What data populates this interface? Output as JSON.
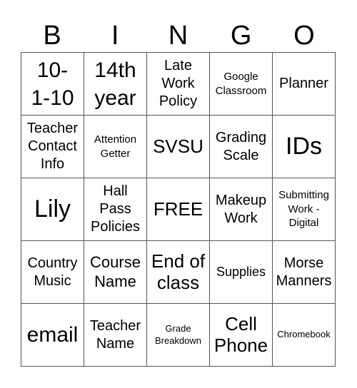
{
  "header": [
    "B",
    "I",
    "N",
    "G",
    "O"
  ],
  "cells": [
    {
      "text": "10-\n1-10",
      "size": "s30"
    },
    {
      "text": "14th\nyear",
      "size": "s30"
    },
    {
      "text": "Late\nWork\nPolicy",
      "size": "s20"
    },
    {
      "text": "Google\nClassroom",
      "size": "s15"
    },
    {
      "text": "Planner",
      "size": "s20"
    },
    {
      "text": "Teacher\nContact\nInfo",
      "size": "s20"
    },
    {
      "text": "Attention\nGetter",
      "size": "s15"
    },
    {
      "text": "SVSU",
      "size": "s26"
    },
    {
      "text": "Grading\nScale",
      "size": "s20"
    },
    {
      "text": "IDs",
      "size": "s34"
    },
    {
      "text": "Lily",
      "size": "s34"
    },
    {
      "text": "Hall\nPass\nPolicies",
      "size": "s20"
    },
    {
      "text": "FREE",
      "size": "s26"
    },
    {
      "text": "Makeup\nWork",
      "size": "s20"
    },
    {
      "text": "Submitting\nWork -\nDigital",
      "size": "s15"
    },
    {
      "text": "Country\nMusic",
      "size": "s20"
    },
    {
      "text": "Course\nName",
      "size": "s22"
    },
    {
      "text": "End of\nclass",
      "size": "s26"
    },
    {
      "text": "Supplies",
      "size": "s18"
    },
    {
      "text": "Morse\nManners",
      "size": "s20"
    },
    {
      "text": "email",
      "size": "s30"
    },
    {
      "text": "Teacher\nName",
      "size": "s20"
    },
    {
      "text": "Grade\nBreakdown",
      "size": "s13"
    },
    {
      "text": "Cell\nPhone",
      "size": "s26"
    },
    {
      "text": "Chromebook",
      "size": "s13"
    }
  ]
}
